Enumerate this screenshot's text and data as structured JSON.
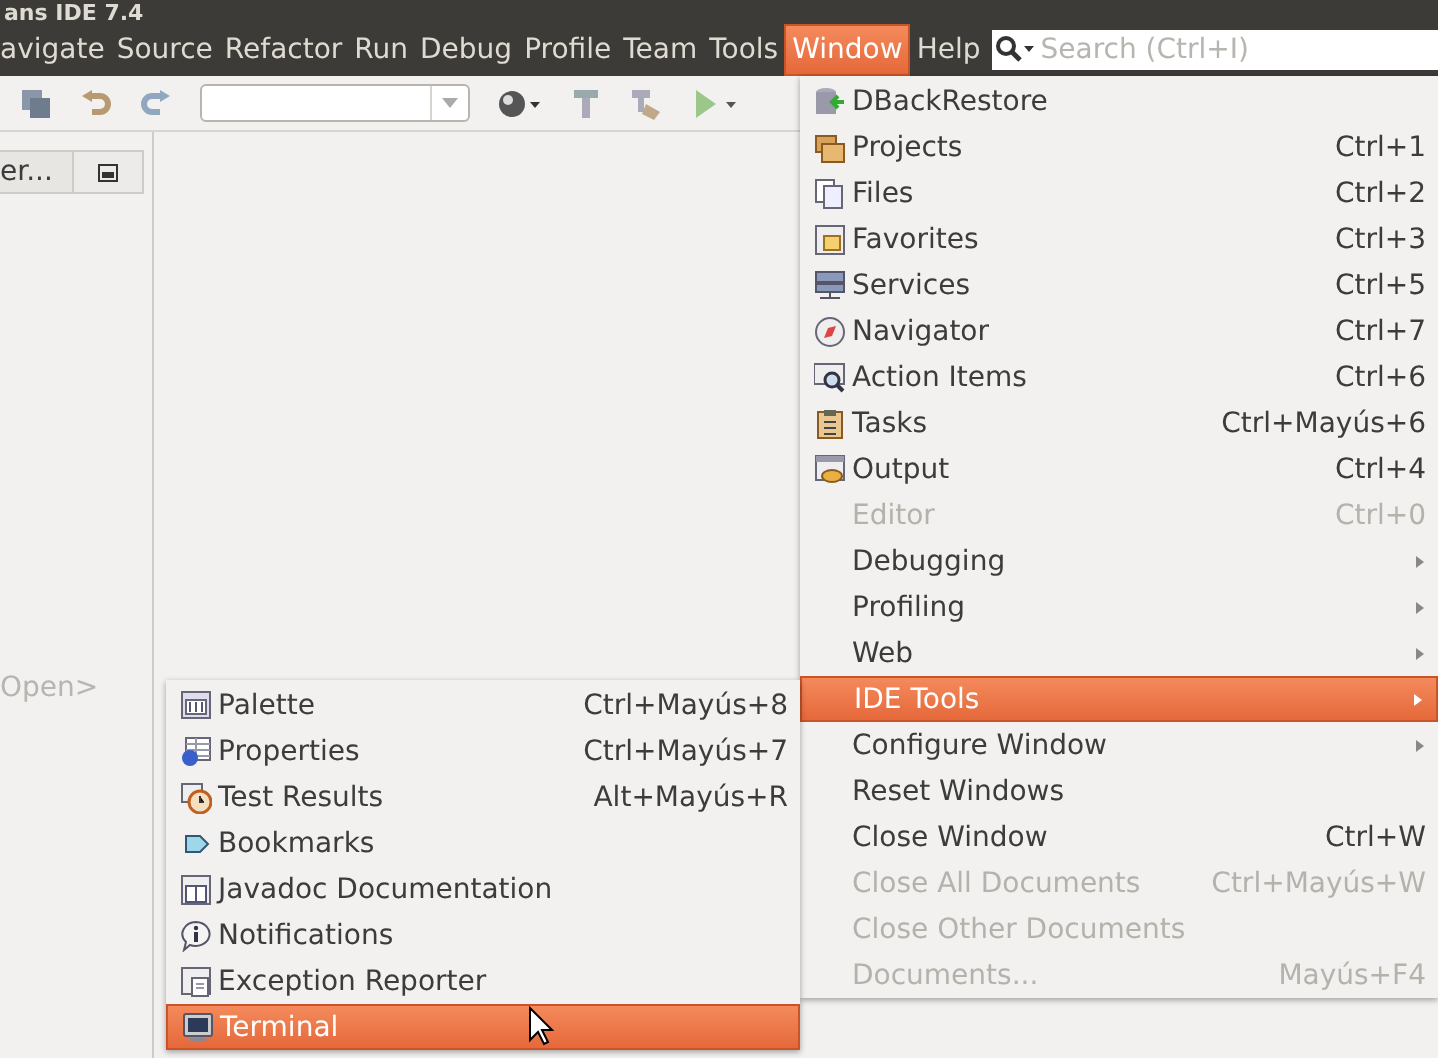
{
  "window": {
    "title": "ans IDE 7.4"
  },
  "menubar": [
    {
      "label": "avigate",
      "selected": false
    },
    {
      "label": "Source",
      "selected": false
    },
    {
      "label": "Refactor",
      "selected": false
    },
    {
      "label": "Run",
      "selected": false
    },
    {
      "label": "Debug",
      "selected": false
    },
    {
      "label": "Profile",
      "selected": false
    },
    {
      "label": "Team",
      "selected": false
    },
    {
      "label": "Tools",
      "selected": false
    },
    {
      "label": "Window",
      "selected": true
    },
    {
      "label": "Help",
      "selected": false
    }
  ],
  "search": {
    "placeholder": "Search (Ctrl+I)"
  },
  "left_panel": {
    "tab": "er...",
    "hint": "Open>"
  },
  "window_menu": [
    {
      "kind": "icon",
      "label": "DBackRestore",
      "disabled": false,
      "submenu": false,
      "selected": false
    },
    {
      "kind": "icon",
      "label": "Projects",
      "shortcut": "Ctrl+1",
      "disabled": false,
      "submenu": false,
      "selected": false
    },
    {
      "kind": "icon",
      "label": "Files",
      "shortcut": "Ctrl+2",
      "disabled": false,
      "submenu": false,
      "selected": false
    },
    {
      "kind": "icon",
      "label": "Favorites",
      "shortcut": "Ctrl+3",
      "disabled": false,
      "submenu": false,
      "selected": false
    },
    {
      "kind": "icon",
      "label": "Services",
      "shortcut": "Ctrl+5",
      "disabled": false,
      "submenu": false,
      "selected": false
    },
    {
      "kind": "icon",
      "label": "Navigator",
      "shortcut": "Ctrl+7",
      "disabled": false,
      "submenu": false,
      "selected": false
    },
    {
      "kind": "icon",
      "label": "Action Items",
      "shortcut": "Ctrl+6",
      "disabled": false,
      "submenu": false,
      "selected": false
    },
    {
      "kind": "icon",
      "label": "Tasks",
      "shortcut": "Ctrl+Mayús+6",
      "disabled": false,
      "submenu": false,
      "selected": false
    },
    {
      "kind": "icon",
      "label": "Output",
      "shortcut": "Ctrl+4",
      "disabled": false,
      "submenu": false,
      "selected": false
    },
    {
      "kind": "text",
      "label": "Editor",
      "shortcut": "Ctrl+0",
      "disabled": true,
      "submenu": false,
      "selected": false
    },
    {
      "kind": "text",
      "label": "Debugging",
      "disabled": false,
      "submenu": true,
      "selected": false
    },
    {
      "kind": "text",
      "label": "Profiling",
      "disabled": false,
      "submenu": true,
      "selected": false
    },
    {
      "kind": "text",
      "label": "Web",
      "disabled": false,
      "submenu": true,
      "selected": false
    },
    {
      "kind": "text",
      "label": "IDE Tools",
      "disabled": false,
      "submenu": true,
      "selected": true
    },
    {
      "kind": "text",
      "label": "Configure Window",
      "disabled": false,
      "submenu": true,
      "selected": false
    },
    {
      "kind": "text",
      "label": "Reset Windows",
      "disabled": false,
      "submenu": false,
      "selected": false
    },
    {
      "kind": "text",
      "label": "Close Window",
      "shortcut": "Ctrl+W",
      "disabled": false,
      "submenu": false,
      "selected": false
    },
    {
      "kind": "text",
      "label": "Close All Documents",
      "shortcut": "Ctrl+Mayús+W",
      "disabled": true,
      "submenu": false,
      "selected": false
    },
    {
      "kind": "text",
      "label": "Close Other Documents",
      "disabled": true,
      "submenu": false,
      "selected": false
    },
    {
      "kind": "text",
      "label": "Documents...",
      "shortcut": "Mayús+F4",
      "disabled": true,
      "submenu": false,
      "selected": false
    }
  ],
  "ide_tools_menu": [
    {
      "kind": "icon",
      "label": "Palette",
      "shortcut": "Ctrl+Mayús+8",
      "disabled": false,
      "submenu": false,
      "selected": false
    },
    {
      "kind": "icon",
      "label": "Properties",
      "shortcut": "Ctrl+Mayús+7",
      "disabled": false,
      "submenu": false,
      "selected": false
    },
    {
      "kind": "icon",
      "label": "Test Results",
      "shortcut": "Alt+Mayús+R",
      "disabled": false,
      "submenu": false,
      "selected": false
    },
    {
      "kind": "icon",
      "label": "Bookmarks",
      "disabled": false,
      "submenu": false,
      "selected": false
    },
    {
      "kind": "icon",
      "label": "Javadoc Documentation",
      "disabled": false,
      "submenu": false,
      "selected": false
    },
    {
      "kind": "icon",
      "label": "Notifications",
      "disabled": false,
      "submenu": false,
      "selected": false
    },
    {
      "kind": "icon",
      "label": "Exception Reporter",
      "disabled": false,
      "submenu": false,
      "selected": false
    },
    {
      "kind": "icon",
      "label": "Terminal",
      "disabled": false,
      "submenu": false,
      "selected": true
    }
  ]
}
